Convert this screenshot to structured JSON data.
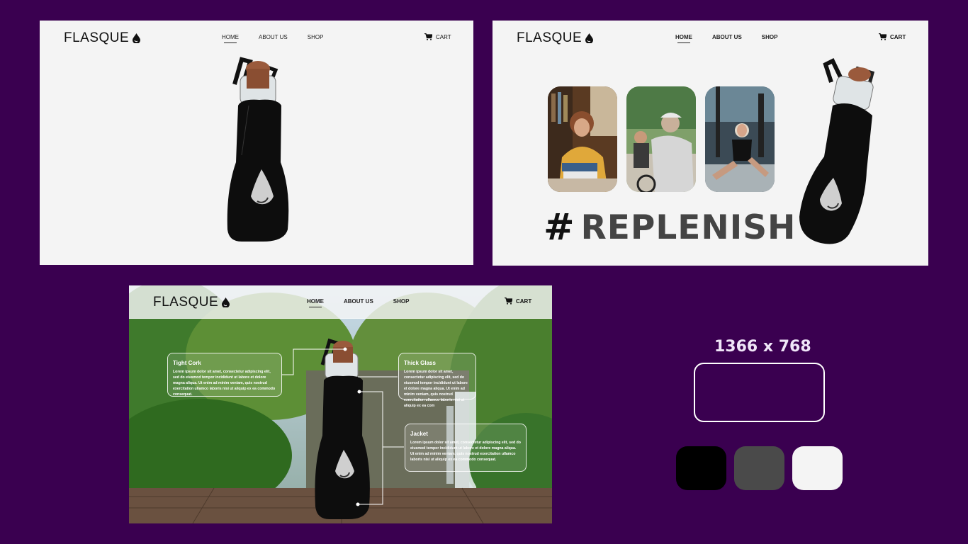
{
  "brand": "FLASQUE",
  "nav": {
    "home": "HOME",
    "about": "ABOUT US",
    "shop": "SHOP",
    "cart": "CART"
  },
  "frame2": {
    "hashtag_symbol": "#",
    "hashtag_text": "REPLENISH"
  },
  "callouts": {
    "cork": {
      "title": "Tight Cork",
      "body": "Lorem ipsum dolor sit amet, consectetur adipiscing elit, sed do eiusmod tempor incididunt ut labore et dolore magna aliqua. Ut enim ad minim veniam, quis nostrud exercitation ullamco laboris nisi ut aliquip ex ea commodo consequat."
    },
    "glass": {
      "title": "Thick Glass",
      "body": "Lorem ipsum dolor sit amet, consectetur adipiscing elit, sed do eiusmod tempor incididunt ut labore et dolore magna aliqua. Ut enim ad minim veniam, quis nostrud exercitation ullamco laboris nisi ut aliquip ex ea com"
    },
    "jacket": {
      "title": "Jacket",
      "body": "Lorem ipsum dolor sit amet, consectetur adipiscing elit, sed do eiusmod tempor incididunt ut labore et dolore magna aliqua. Ut enim ad minim veniam, quis nostrud exercitation ullamco laboris nisi ut aliquip ex ea commodo consequat."
    }
  },
  "resolution_label": "1366 x 768",
  "palette": [
    "#000000",
    "#4a4a4a",
    "#f4f4f4"
  ],
  "colors": {
    "background": "#3a0050",
    "frame": "#f4f4f4"
  }
}
